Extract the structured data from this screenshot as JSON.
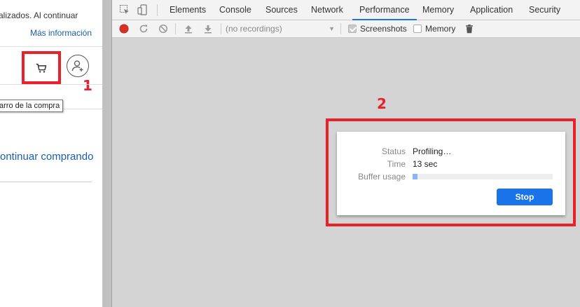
{
  "page": {
    "cookie_text": "alizados. Al continuar",
    "more_info_link": "Más información",
    "tooltip": "arro de la compra",
    "continue_link": "ontinuar comprando"
  },
  "annotations": {
    "one": "1",
    "two": "2"
  },
  "devtools": {
    "tabs": [
      "Elements",
      "Console",
      "Sources",
      "Network",
      "Performance",
      "Memory",
      "Application",
      "Security"
    ],
    "active_tab": "Performance",
    "toolbar": {
      "recordings_placeholder": "(no recordings)",
      "screenshots_label": "Screenshots",
      "screenshots_checked": true,
      "memory_label": "Memory",
      "memory_checked": false
    },
    "dialog": {
      "status_label": "Status",
      "status_value": "Profiling…",
      "time_label": "Time",
      "time_value": "13 sec",
      "buffer_label": "Buffer usage",
      "buffer_fraction": 0.035,
      "stop_label": "Stop"
    }
  },
  "colors": {
    "annotation_red": "#e8212b",
    "link_blue": "#1a5ea8",
    "accent_blue": "#1a73e8",
    "record_red": "#d93025"
  }
}
